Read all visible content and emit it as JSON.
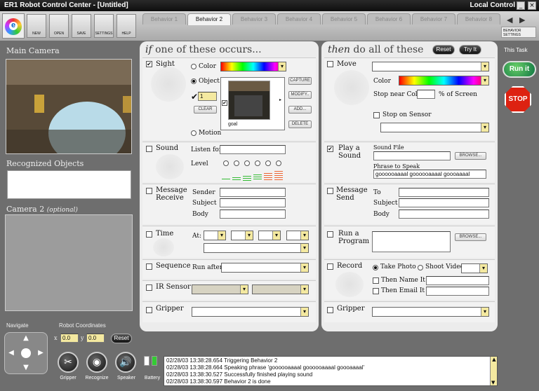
{
  "window": {
    "title": "ER1 Robot Control Center - [Untitled]",
    "mode": "Local Control",
    "min": "_",
    "close": "×"
  },
  "toolbar": {
    "new": "NEW",
    "open": "OPEN",
    "save": "SAVE",
    "settings": "SETTINGS",
    "help": "HELP",
    "behavior_settings": "BEHAVIOR SETTINGS"
  },
  "tabs": [
    "Behavior 1",
    "Behavior 2",
    "Behavior 3",
    "Behavior 4",
    "Behavior 5",
    "Behavior 6",
    "Behavior 7",
    "Behavior 8"
  ],
  "left": {
    "main_camera": "Main Camera",
    "recognized": "Recognized Objects",
    "camera2": "Camera 2",
    "camera2_opt": "(optional)",
    "navigate": "Navigate",
    "coords": "Robot Coordinates",
    "x_lbl": "x",
    "y_lbl": "y",
    "x_val": "0.0",
    "y_val": "0.0",
    "reset": "Reset"
  },
  "bottom": {
    "gripper": "Gripper",
    "recognize": "Recognize",
    "speaker": "Speaker",
    "battery": "Battery"
  },
  "if_panel": {
    "if_word": "if",
    "header": "one of these occurs...",
    "sight": {
      "label": "Sight",
      "color": "Color",
      "object": "Object",
      "count": "1",
      "clear": "CLEAR",
      "capture": "CAPTURE",
      "modify": "MODIFY..",
      "add": "ADD...",
      "delete": "DELETE",
      "goal": "goal",
      "motion": "Motion"
    },
    "sound": {
      "label": "Sound",
      "listen": "Listen for",
      "level": "Level"
    },
    "message": {
      "label": "Message Receive",
      "sender": "Sender",
      "subject": "Subject",
      "body": "Body"
    },
    "time": {
      "label": "Time",
      "at": "At:"
    },
    "sequence": {
      "label": "Sequence",
      "run_after": "Run after"
    },
    "ir": {
      "label": "IR Sensor"
    },
    "gripper": {
      "label": "Gripper"
    }
  },
  "then_panel": {
    "then_word": "then",
    "header": "do all of these",
    "reset": "Reset",
    "tryit": "Try It",
    "move": {
      "label": "Move",
      "color": "Color",
      "stop_near": "Stop near Color",
      "pct": "% of Screen",
      "stop_sensor": "Stop on Sensor"
    },
    "play": {
      "label": "Play a Sound",
      "sound_file": "Sound File",
      "browse": "BROWSE...",
      "phrase": "Phrase to Speak",
      "phrase_val": "goooooaaaal goooooaaaal goooaaaal"
    },
    "message": {
      "label": "Message Send",
      "to": "To",
      "subject": "Subject",
      "body": "Body"
    },
    "program": {
      "label": "Run a Program",
      "browse": "BROWSE..."
    },
    "record": {
      "label": "Record",
      "photo": "Take Photo",
      "video": "Shoot Video",
      "name": "Then Name It",
      "email": "Then Email It to"
    },
    "gripper": {
      "label": "Gripper"
    }
  },
  "right": {
    "this_task": "This Task",
    "run": "Run it",
    "stop": "STOP"
  },
  "log": [
    "02/28/03 13:38:28.654 Triggering Behavior 2",
    "02/28/03 13:38:28.664 Speaking phrase 'goooooaaaal goooooaaaal goooaaaal'",
    "02/28/03 13:38:30.527 Successfully finished playing sound",
    "02/28/03 13:38:30.597 Behavior 2 is done"
  ]
}
